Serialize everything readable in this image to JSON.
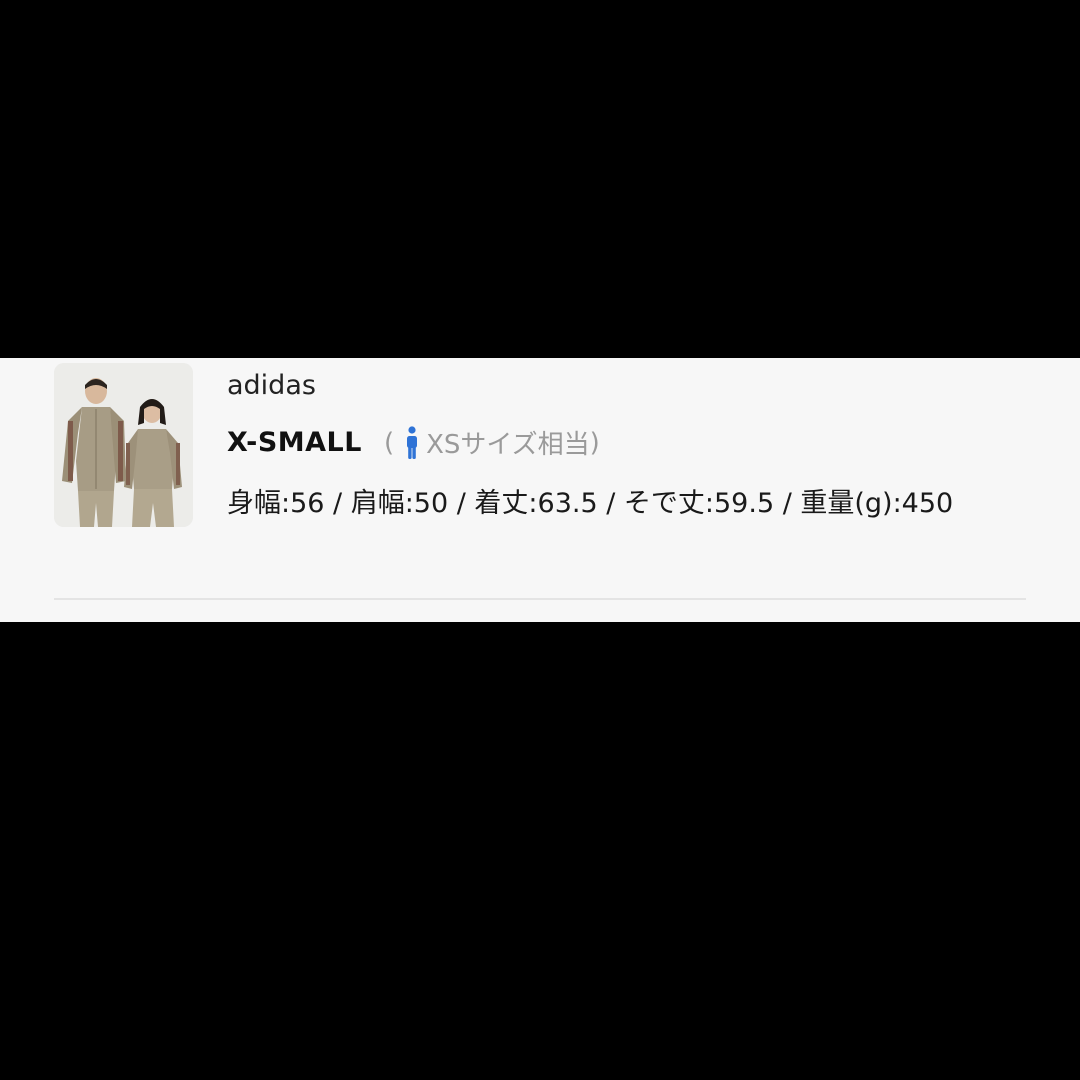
{
  "item": {
    "brand": "adidas",
    "size_label": "X-SMALL",
    "size_hint_open": "(",
    "size_hint_text": "XSサイズ相当",
    "size_hint_close": ")",
    "measurements": "身幅:56 / 肩幅:50 / 着丈:63.5 / そで丈:59.5 / 重量(g):450",
    "thumbnail_icon": "product-photo",
    "size_icon": "person-icon"
  },
  "colors": {
    "accent": "#2f73d6",
    "background": "#000000",
    "card": "#f7f7f7"
  }
}
